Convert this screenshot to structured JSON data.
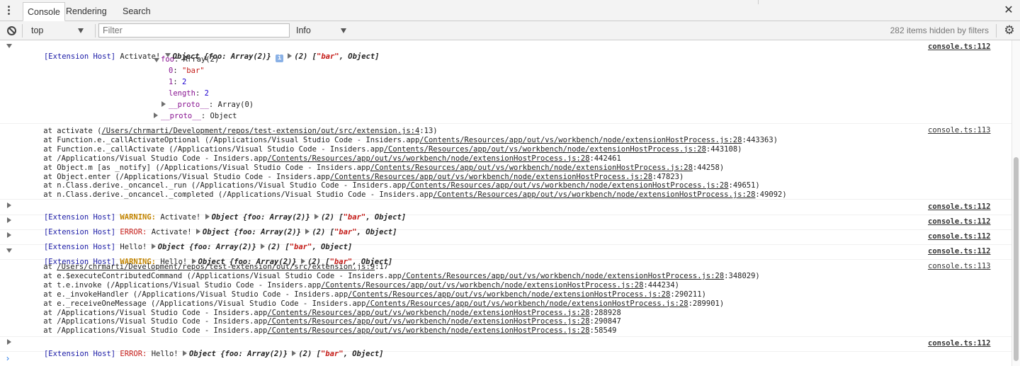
{
  "tabs": [
    {
      "label": "Console"
    },
    {
      "label": "Rendering"
    },
    {
      "label": "Search"
    }
  ],
  "toolbar": {
    "context": "top",
    "filter_placeholder": "Filter",
    "level": "Info",
    "hidden_items": "282 items hidden by filters"
  },
  "icons": [
    "kebab-menu-icon",
    "close-icon",
    "clear-console-icon",
    "chevron-down-icon",
    "settings-gear-icon",
    "info-icon",
    "prompt-chevron-icon"
  ],
  "messages": {
    "m1": {
      "tag": "[Extension Host]",
      "text": "Activate!",
      "object": "Object {foo: Array(2)}",
      "array_open": "(2) [",
      "array_str": "\"bar\"",
      "array_close": ", Object]",
      "source": "console.ts:112",
      "tree": {
        "foo_key": "foo",
        "foo_val": ": Array(2)",
        "i0_key": "0",
        "i0_val": "\"bar\"",
        "i1_key": "1",
        "i1_val": "2",
        "len_key": "length",
        "len_val": "2",
        "proto_inner_key": "__proto__",
        "proto_inner_val": ": Array(0)",
        "proto_key": "__proto__",
        "proto_val": ": Object"
      }
    },
    "trace1": {
      "source": "console.ts:113",
      "lines": [
        {
          "pre": "    at activate (",
          "link": "/Users/chrmarti/Development/repos/test-extension/out/src/extension.js:4",
          "post": ":13)"
        },
        {
          "pre": "    at Function.e._callActivateOptional (/Applications/Visual Studio Code - Insiders.app",
          "link": "/Contents/Resources/app/out/vs/workbench/node/extensionHostProcess.js:28",
          "post": ":443363)"
        },
        {
          "pre": "    at Function.e._callActivate (/Applications/Visual Studio Code - Insiders.app",
          "link": "/Contents/Resources/app/out/vs/workbench/node/extensionHostProcess.js:28",
          "post": ":443108)"
        },
        {
          "pre": "    at /Applications/Visual Studio Code - Insiders.app",
          "link": "/Contents/Resources/app/out/vs/workbench/node/extensionHostProcess.js:28",
          "post": ":442461"
        },
        {
          "pre": "    at Object.m [as _notify] (/Applications/Visual Studio Code - Insiders.app",
          "link": "/Contents/Resources/app/out/vs/workbench/node/extensionHostProcess.js:28",
          "post": ":44258)"
        },
        {
          "pre": "    at Object.enter (/Applications/Visual Studio Code - Insiders.app",
          "link": "/Contents/Resources/app/out/vs/workbench/node/extensionHostProcess.js:28",
          "post": ":47823)"
        },
        {
          "pre": "    at n.Class.derive._oncancel._run (/Applications/Visual Studio Code - Insiders.app",
          "link": "/Contents/Resources/app/out/vs/workbench/node/extensionHostProcess.js:28",
          "post": ":49651)"
        },
        {
          "pre": "    at n.Class.derive._oncancel._completed (/Applications/Visual Studio Code - Insiders.app",
          "link": "/Contents/Resources/app/out/vs/workbench/node/extensionHostProcess.js:28",
          "post": ":49092)"
        }
      ]
    },
    "m2": {
      "tag": "[Extension Host]",
      "level": "WARNING:",
      "text": "Activate!",
      "object": "Object {foo: Array(2)}",
      "array_open": "(2) [",
      "array_str": "\"bar\"",
      "array_close": ", Object]",
      "source": "console.ts:112"
    },
    "m3": {
      "tag": "[Extension Host]",
      "level": "ERROR:",
      "text": "Activate!",
      "object": "Object {foo: Array(2)}",
      "array_open": "(2) [",
      "array_str": "\"bar\"",
      "array_close": ", Object]",
      "source": "console.ts:112"
    },
    "m4": {
      "tag": "[Extension Host]",
      "text": "Hello!",
      "object": "Object {foo: Array(2)}",
      "array_open": "(2) [",
      "array_str": "\"bar\"",
      "array_close": ", Object]",
      "source": "console.ts:112"
    },
    "m5": {
      "tag": "[Extension Host]",
      "level": "WARNING:",
      "text": "Hello!",
      "object": "Object {foo: Array(2)}",
      "array_open": "(2) [",
      "array_str": "\"bar\"",
      "array_close": ", Object]",
      "source": "console.ts:112"
    },
    "trace2": {
      "source": "console.ts:113",
      "lines": [
        {
          "pre": "    at ",
          "link": "/Users/chrmarti/Development/repos/test-extension/out/src/extension.js:9",
          "post": ":17"
        },
        {
          "pre": "    at e.$executeContributedCommand (/Applications/Visual Studio Code - Insiders.app",
          "link": "/Contents/Resources/app/out/vs/workbench/node/extensionHostProcess.js:28",
          "post": ":348029)"
        },
        {
          "pre": "    at t.e.invoke (/Applications/Visual Studio Code - Insiders.app",
          "link": "/Contents/Resources/app/out/vs/workbench/node/extensionHostProcess.js:28",
          "post": ":444234)"
        },
        {
          "pre": "    at e._invokeHandler (/Applications/Visual Studio Code - Insiders.app",
          "link": "/Contents/Resources/app/out/vs/workbench/node/extensionHostProcess.js:28",
          "post": ":290211)"
        },
        {
          "pre": "    at e._receiveOneMessage (/Applications/Visual Studio Code - Insiders.app",
          "link": "/Contents/Resources/app/out/vs/workbench/node/extensionHostProcess.js:28",
          "post": ":289901)"
        },
        {
          "pre": "    at /Applications/Visual Studio Code - Insiders.app",
          "link": "/Contents/Resources/app/out/vs/workbench/node/extensionHostProcess.js:28",
          "post": ":288928"
        },
        {
          "pre": "    at /Applications/Visual Studio Code - Insiders.app",
          "link": "/Contents/Resources/app/out/vs/workbench/node/extensionHostProcess.js:28",
          "post": ":290847"
        },
        {
          "pre": "    at /Applications/Visual Studio Code - Insiders.app",
          "link": "/Contents/Resources/app/out/vs/workbench/node/extensionHostProcess.js:28",
          "post": ":58549"
        }
      ]
    },
    "m6": {
      "tag": "[Extension Host]",
      "level": "ERROR:",
      "text": "Hello!",
      "object": "Object {foo: Array(2)}",
      "array_open": "(2) [",
      "array_str": "\"bar\"",
      "array_close": ", Object]",
      "source": "console.ts:112"
    }
  }
}
